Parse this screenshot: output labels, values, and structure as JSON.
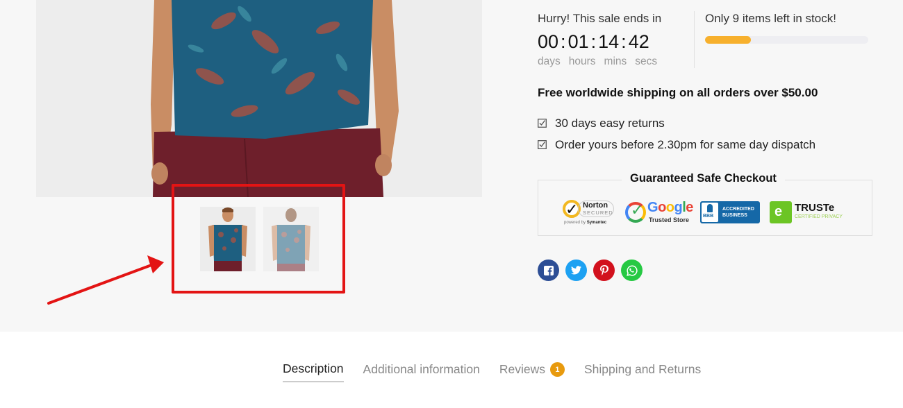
{
  "product": {
    "main_image_alt": "Model wearing blue floral print t-shirt with burgundy shorts",
    "thumbnails": [
      {
        "alt": "Front view of floral t-shirt"
      },
      {
        "alt": "Back view of floral t-shirt"
      }
    ]
  },
  "countdown": {
    "title": "Hurry! This sale ends in",
    "values": {
      "days": "00",
      "hours": "01",
      "mins": "14",
      "secs": "42"
    },
    "separator": ":",
    "labels": {
      "days": "days",
      "hours": "hours",
      "mins": "mins",
      "secs": "secs"
    }
  },
  "stock": {
    "text": "Only 9 items left in stock!",
    "progress_percent": 28,
    "bar_color": "#f7b02d"
  },
  "shipping": {
    "headline": "Free worldwide shipping on all orders over $50.00",
    "perks": [
      {
        "icon": "checkbox-checked-icon",
        "label": "30 days easy returns"
      },
      {
        "icon": "checkbox-checked-icon",
        "label": "Order yours before 2.30pm for same day dispatch"
      }
    ]
  },
  "checkout": {
    "title": "Guaranteed Safe Checkout",
    "badges": {
      "norton": {
        "name": "Norton",
        "sub": "SECURED",
        "powered_prefix": "powered by",
        "powered_brand": "Symantec"
      },
      "google": {
        "letters": [
          "G",
          "o",
          "o",
          "g",
          "l",
          "e"
        ],
        "colors": [
          "#4285f4",
          "#e94235",
          "#fbbc05",
          "#4285f4",
          "#34a853",
          "#e94235"
        ],
        "sub": "Trusted Store"
      },
      "bbb": {
        "logo": "BBB",
        "line1": "ACCREDITED",
        "line2": "BUSINESS"
      },
      "truste": {
        "name": "TRUSTe",
        "sub": "CERTIFIED PRIVACY"
      }
    }
  },
  "social": [
    {
      "name": "facebook",
      "glyph": "f",
      "color": "#2d4e95"
    },
    {
      "name": "twitter",
      "glyph": "t",
      "color": "#1da1f2"
    },
    {
      "name": "pinterest",
      "glyph": "p",
      "color": "#d2111d"
    },
    {
      "name": "whatsapp",
      "glyph": "w",
      "color": "#26c943"
    }
  ],
  "tabs": [
    {
      "label": "Description",
      "active": true
    },
    {
      "label": "Additional information",
      "active": false
    },
    {
      "label": "Reviews",
      "active": false,
      "badge": "1"
    },
    {
      "label": "Shipping and Returns",
      "active": false
    }
  ],
  "annotation": {
    "color": "#e31414"
  }
}
